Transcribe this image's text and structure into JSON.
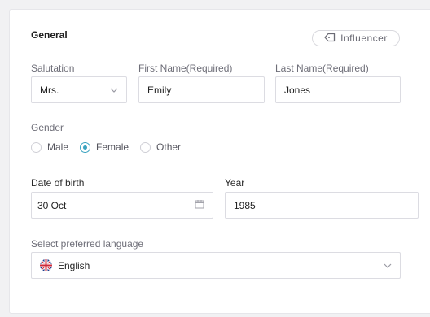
{
  "section": {
    "title": "General",
    "tag_label": "Influencer",
    "tag_icon": "tag-icon"
  },
  "salutation": {
    "label": "Salutation",
    "value": "Mrs."
  },
  "first_name": {
    "label": "First Name(Required)",
    "value": "Emily"
  },
  "last_name": {
    "label": "Last Name(Required)",
    "value": "Jones"
  },
  "gender": {
    "label": "Gender",
    "options": [
      "Male",
      "Female",
      "Other"
    ],
    "selected": "Female"
  },
  "dob": {
    "label": "Date of birth",
    "value": "30 Oct"
  },
  "year": {
    "label": "Year",
    "value": "1985"
  },
  "language": {
    "label": "Select preferred language",
    "value": "English",
    "flag": "uk-flag-icon"
  },
  "colors": {
    "accent": "#3ba3c0",
    "border": "#dcdce2"
  }
}
